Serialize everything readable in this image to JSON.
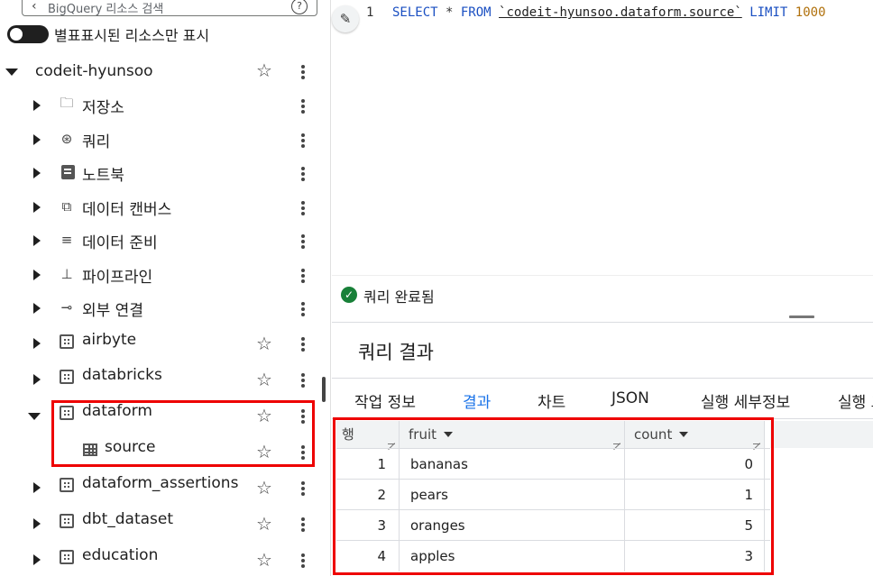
{
  "explorer": {
    "search_placeholder": "BigQuery 리소스 검색",
    "toggle_label": "별표표시된 리소스만 표시",
    "project": "codeit-hyunsoo",
    "items": [
      {
        "label": "저장소",
        "icon": "storage-icon"
      },
      {
        "label": "쿼리",
        "icon": "query-icon"
      },
      {
        "label": "노트북",
        "icon": "notebook-icon"
      },
      {
        "label": "데이터 캔버스",
        "icon": "data-canvas-icon"
      },
      {
        "label": "데이터 준비",
        "icon": "data-prep-icon"
      },
      {
        "label": "파이프라인",
        "icon": "pipeline-icon"
      },
      {
        "label": "외부 연결",
        "icon": "external-connection-icon"
      }
    ],
    "datasets": [
      {
        "label": "airbyte"
      },
      {
        "label": "databricks"
      },
      {
        "label": "dataform",
        "expanded": true
      },
      {
        "label": "source",
        "table": true
      },
      {
        "label": "dataform_assertions"
      },
      {
        "label": "dbt_dataset"
      },
      {
        "label": "education"
      }
    ]
  },
  "editor": {
    "line_number": "1",
    "code": {
      "select": "SELECT",
      "star": " * ",
      "from": "FROM",
      "table": "`codeit-hyunsoo.dataform.source`",
      "limit": "LIMIT",
      "limit_value": "1000"
    },
    "status": "쿼리 완료됨"
  },
  "results": {
    "title": "쿼리 결과",
    "tabs": [
      "작업 정보",
      "결과",
      "차트",
      "JSON",
      "실행 세부정보",
      "실행 그"
    ],
    "active_tab": "결과",
    "columns": {
      "row": "행",
      "fruit": "fruit",
      "count": "count"
    },
    "rows": [
      {
        "idx": "1",
        "fruit": "bananas",
        "count": "0"
      },
      {
        "idx": "2",
        "fruit": "pears",
        "count": "1"
      },
      {
        "idx": "3",
        "fruit": "oranges",
        "count": "5"
      },
      {
        "idx": "4",
        "fruit": "apples",
        "count": "3"
      }
    ]
  },
  "colors": {
    "accent": "#1a73e8",
    "highlight": "#e00000",
    "success": "#188038"
  }
}
